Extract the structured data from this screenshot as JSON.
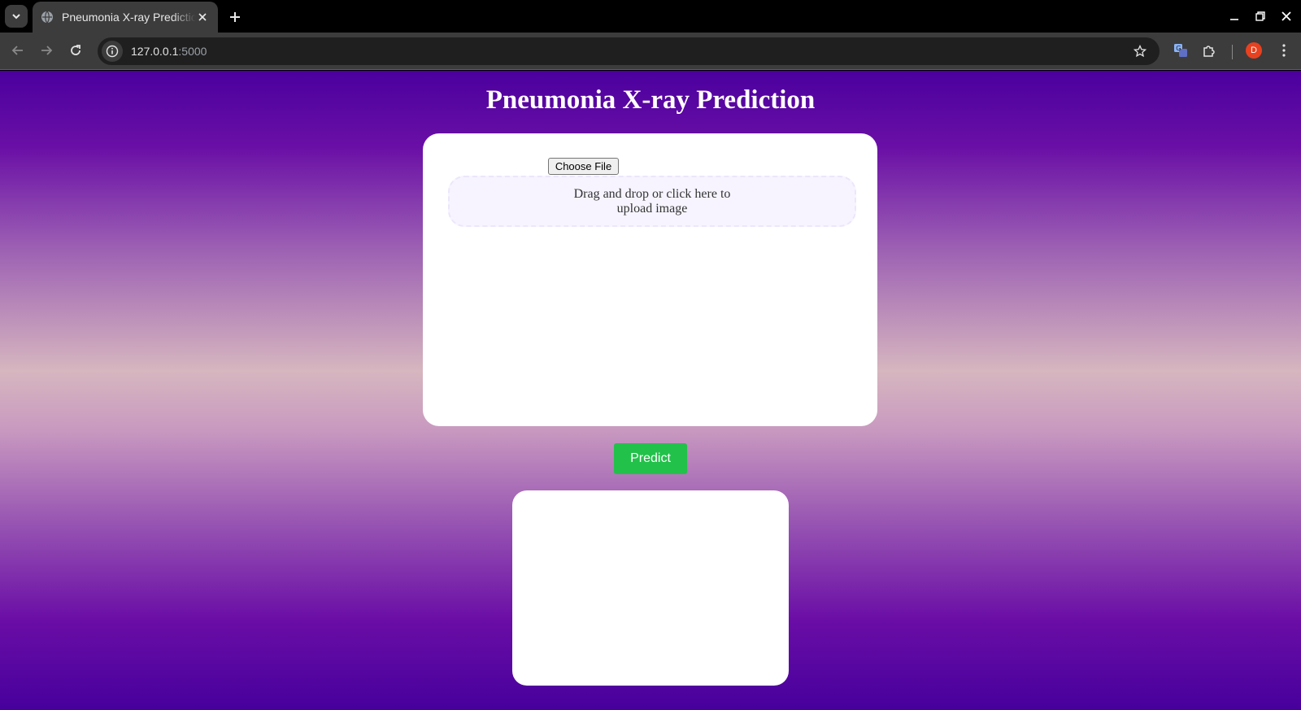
{
  "browser": {
    "tab_title": "Pneumonia X-ray Prediction",
    "url_host": "127.0.0.1",
    "url_port": ":5000",
    "profile_initial": "D"
  },
  "page": {
    "title": "Pneumonia X-ray Prediction",
    "file_button_label": "Choose File",
    "dropzone_text": "Drag and drop or click here to upload image",
    "predict_label": "Predict",
    "result_text": ""
  },
  "colors": {
    "accent_green": "#22c14a",
    "gradient_top": "#4b009e",
    "gradient_mid": "#d6b6bf"
  },
  "icons": [
    "tab-search-icon",
    "globe-icon",
    "close-icon",
    "plus-icon",
    "minimize-icon",
    "restore-icon",
    "back-icon",
    "forward-icon",
    "reload-icon",
    "info-icon",
    "star-icon",
    "translate-icon",
    "extensions-icon",
    "menu-icon"
  ]
}
